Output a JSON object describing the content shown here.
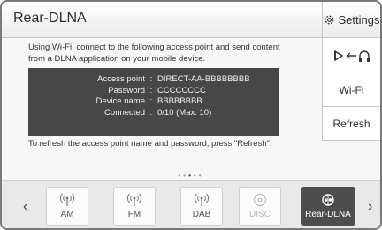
{
  "header": {
    "title": "Rear-DLNA",
    "settings_label": "Settings"
  },
  "content": {
    "intro": "Using Wi-Fi, connect to the following access point and send content from a DLNA application on your mobile device.",
    "info": [
      {
        "label": "Access point",
        "value": "DIRECT-AA-BBBBBBBB"
      },
      {
        "label": "Password",
        "value": "CCCCCCCC"
      },
      {
        "label": "Device name",
        "value": "BBBBBBBB"
      },
      {
        "label": "Connected",
        "value": "0/10 (Max: 10)"
      }
    ],
    "hint": "To refresh the access point name and password, press \"Refresh\"."
  },
  "side": {
    "wifi_label": "Wi-Fi",
    "refresh_label": "Refresh"
  },
  "sources": [
    {
      "label": "AM",
      "icon": "antenna-icon",
      "state": "enabled"
    },
    {
      "label": "FM",
      "icon": "antenna-icon",
      "state": "enabled"
    },
    {
      "label": "DAB",
      "icon": "antenna-icon",
      "state": "enabled"
    },
    {
      "label": "DISC",
      "icon": "disc-icon",
      "state": "disabled"
    },
    {
      "label": "Rear-DLNA",
      "icon": "dlna-icon",
      "state": "active"
    }
  ],
  "colors": {
    "active_tile": "#4d4d4d",
    "info_box": "#474747"
  }
}
